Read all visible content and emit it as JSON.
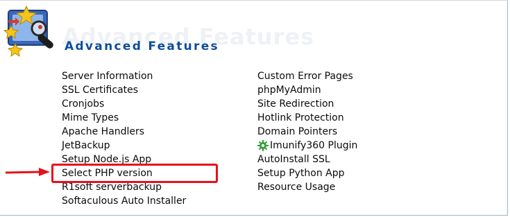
{
  "header": {
    "title": "Advanced Features",
    "watermark": "Advanced Features"
  },
  "left_column": [
    {
      "label": "Server Information"
    },
    {
      "label": "SSL Certificates"
    },
    {
      "label": "Cronjobs"
    },
    {
      "label": "Mime Types"
    },
    {
      "label": "Apache Handlers"
    },
    {
      "label": "JetBackup"
    },
    {
      "label": "Setup Node.js App"
    },
    {
      "label": "Select PHP version",
      "highlighted": true
    },
    {
      "label": "R1soft serverbackup"
    },
    {
      "label": "Softaculous Auto Installer"
    }
  ],
  "right_column": [
    {
      "label": "Custom Error Pages"
    },
    {
      "label": "phpMyAdmin"
    },
    {
      "label": "Site Redirection"
    },
    {
      "label": "Hotlink Protection"
    },
    {
      "label": "Domain Pointers"
    },
    {
      "label": "Imunify360 Plugin",
      "icon": "gear-icon"
    },
    {
      "label": "AutoInstall SSL"
    },
    {
      "label": "Setup Python App"
    },
    {
      "label": "Resource Usage"
    }
  ],
  "colors": {
    "title": "#0d4d9c",
    "highlight": "#e8101a",
    "gear": "#2e9e3a"
  }
}
